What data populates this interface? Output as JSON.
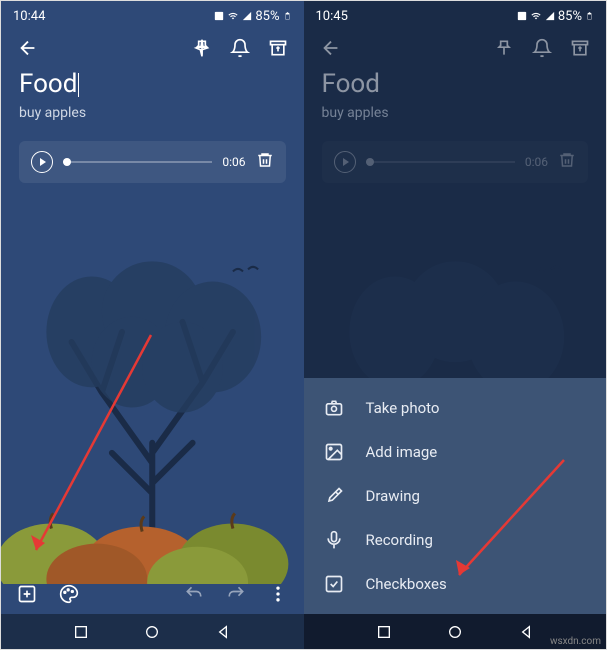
{
  "status": {
    "time_left": "10:44",
    "time_right": "10:45",
    "battery": "85%"
  },
  "note": {
    "title": "Food",
    "body": "buy apples",
    "audio_duration": "0:06"
  },
  "menu": {
    "items": [
      {
        "icon": "camera",
        "label": "Take photo"
      },
      {
        "icon": "image",
        "label": "Add image"
      },
      {
        "icon": "brush",
        "label": "Drawing"
      },
      {
        "icon": "mic",
        "label": "Recording"
      },
      {
        "icon": "checkbox",
        "label": "Checkboxes"
      }
    ]
  },
  "watermark": "wsxdn.com"
}
